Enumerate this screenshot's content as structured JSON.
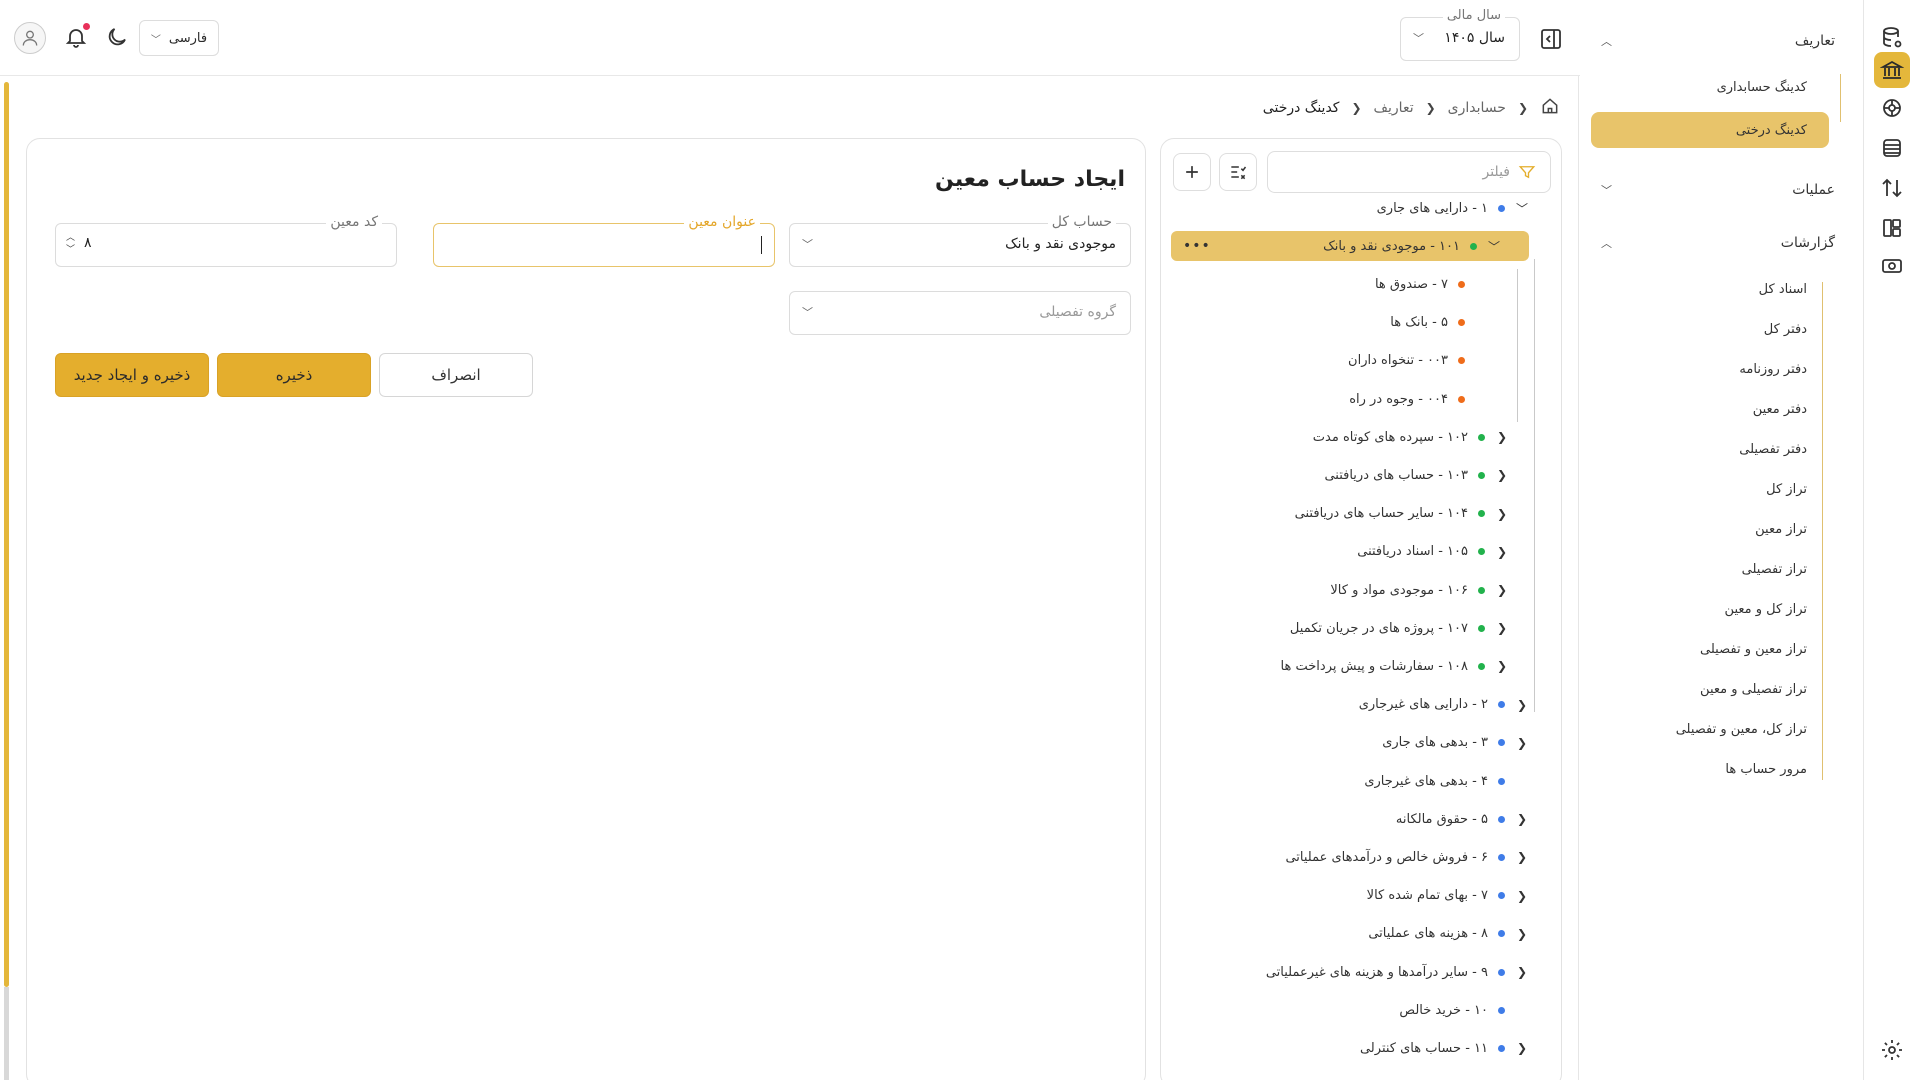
{
  "header": {
    "fiscal_year_label": "سال مالی",
    "fiscal_year_value": "سال ۱۴۰۵",
    "language": "فارسی"
  },
  "sidebar": {
    "groups": [
      {
        "label": "تعاریف",
        "expanded": true
      },
      {
        "label": "عملیات",
        "expanded": false
      },
      {
        "label": "گزارشات",
        "expanded": true
      }
    ],
    "definitions_items": [
      "کدینگ حسابداری",
      "کدینگ درختی"
    ],
    "active_item": "کدینگ درختی",
    "reports_items": [
      "اسناد کل",
      "دفتر کل",
      "دفتر روزنامه",
      "دفتر معین",
      "دفتر تفصیلی",
      "تراز کل",
      "تراز معین",
      "تراز تفصیلی",
      "تراز کل و معین",
      "تراز معین و تفصیلی",
      "تراز تفصیلی و معین",
      "تراز کل، معین و تفصیلی",
      "مرور حساب ها"
    ]
  },
  "breadcrumb": [
    "حسابداری",
    "تعاریف",
    "کدینگ درختی"
  ],
  "tree": {
    "filter_placeholder": "فیلتر",
    "nodes": [
      {
        "label": "۱ - دارایی های جاری",
        "dot": "blue",
        "chevron": "down",
        "level": 0
      },
      {
        "label": "۱۰۱ - موجودی نقد و بانک",
        "dot": "green",
        "chevron": "down",
        "level": 1,
        "selected": true
      },
      {
        "label": "۷ - صندوق ها",
        "dot": "orange",
        "chevron": "none",
        "level": 2
      },
      {
        "label": "۵ - بانک ها",
        "dot": "orange",
        "chevron": "none",
        "level": 2
      },
      {
        "label": "۰۰۳ - تنخواه داران",
        "dot": "orange",
        "chevron": "none",
        "level": 2
      },
      {
        "label": "۰۰۴ - وجوه در راه",
        "dot": "orange",
        "chevron": "none",
        "level": 2
      },
      {
        "label": "۱۰۲ - سپرده های کوتاه مدت",
        "dot": "green",
        "chevron": "left",
        "level": 1
      },
      {
        "label": "۱۰۳ - حساب های دریافتنی",
        "dot": "green",
        "chevron": "left",
        "level": 1
      },
      {
        "label": "۱۰۴ - سایر حساب های دریافتنی",
        "dot": "green",
        "chevron": "left",
        "level": 1
      },
      {
        "label": "۱۰۵ - اسناد دریافتنی",
        "dot": "green",
        "chevron": "left",
        "level": 1
      },
      {
        "label": "۱۰۶ - موجودی مواد و کالا",
        "dot": "green",
        "chevron": "left",
        "level": 1
      },
      {
        "label": "۱۰۷ - پروژه های در جریان تکمیل",
        "dot": "green",
        "chevron": "left",
        "level": 1
      },
      {
        "label": "۱۰۸ - سفارشات و پیش پرداخت ها",
        "dot": "green",
        "chevron": "left",
        "level": 1
      },
      {
        "label": "۲ - دارایی های غیرجاری",
        "dot": "blue",
        "chevron": "left",
        "level": 0
      },
      {
        "label": "۳ - بدهی های جاری",
        "dot": "blue",
        "chevron": "left",
        "level": 0
      },
      {
        "label": "۴ - بدهی های غیرجاری",
        "dot": "blue",
        "chevron": "none",
        "level": 0
      },
      {
        "label": "۵ - حقوق مالکانه",
        "dot": "blue",
        "chevron": "left",
        "level": 0
      },
      {
        "label": "۶ - فروش خالص و درآمدهای عملیاتی",
        "dot": "blue",
        "chevron": "left",
        "level": 0
      },
      {
        "label": "۷ - بهای تمام شده کالا",
        "dot": "blue",
        "chevron": "left",
        "level": 0
      },
      {
        "label": "۸ - هزینه های عملیاتی",
        "dot": "blue",
        "chevron": "left",
        "level": 0
      },
      {
        "label": "۹ - سایر درآمدها و هزینه های غیرعملیاتی",
        "dot": "blue",
        "chevron": "left",
        "level": 0
      },
      {
        "label": "۱۰ - خرید خالص",
        "dot": "blue",
        "chevron": "none",
        "level": 0
      },
      {
        "label": "۱۱ - حساب های کنترلی",
        "dot": "blue",
        "chevron": "left",
        "level": 0
      }
    ],
    "more_label": "•••"
  },
  "form": {
    "title": "ایجاد حساب معین",
    "general_account_label": "حساب کل",
    "general_account_value": "موجودی نقد و بانک",
    "subsidiary_title_label": "عنوان معین",
    "subsidiary_title_value": "",
    "subsidiary_code_label": "کد معین",
    "subsidiary_code_value": "۸",
    "detail_group_placeholder": "گروه تفصیلی",
    "save_new_label": "ذخیره و ایجاد جدید",
    "save_label": "ذخیره",
    "cancel_label": "انصراف"
  },
  "colors": {
    "accent": "#e4ae2d",
    "selected_bg": "#e8c46a",
    "dot_blue": "#3f7ce8",
    "dot_green": "#22b24c",
    "dot_orange": "#ef6c1a",
    "notification": "#e8305a"
  }
}
